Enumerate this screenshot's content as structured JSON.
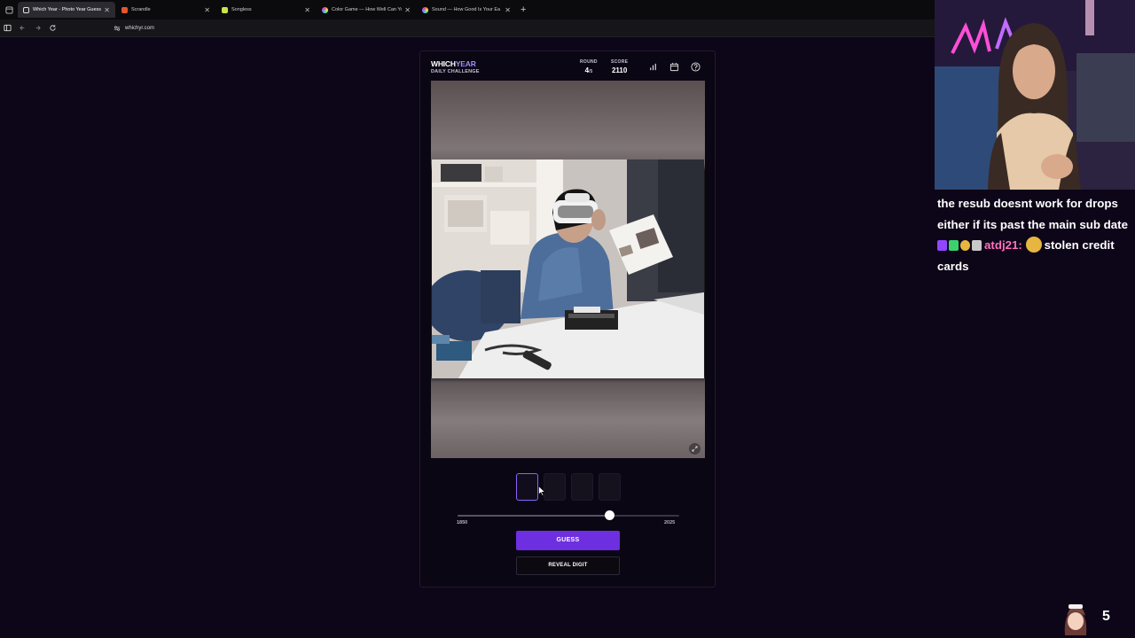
{
  "browser": {
    "tabs": [
      {
        "title": "Which Year - Photo Year Guessi",
        "active": true,
        "favicon_color": "#ffffff"
      },
      {
        "title": "Scrandle",
        "active": false,
        "favicon_color": "#e4572e"
      },
      {
        "title": "Songless",
        "active": false,
        "favicon_color": "#c9e34a"
      },
      {
        "title": "Color Game — How Well Can Yo",
        "active": false,
        "favicon_color": "#ff4fa0"
      },
      {
        "title": "Sound — How Good Is Your Ea",
        "active": false,
        "favicon_color": "#ff4fa0"
      }
    ],
    "tab_close": "✕",
    "new_tab": "+",
    "url": "whichyr.com"
  },
  "game": {
    "logo_which": "WHICH",
    "logo_year": "YEAR",
    "subtitle": "DAILY CHALLENGE",
    "round_label": "ROUND",
    "round_value": "4",
    "round_total": "/5",
    "score_label": "SCORE",
    "score_value": "2110",
    "digits": [
      "",
      "",
      "",
      ""
    ],
    "slider": {
      "min_label": "1850",
      "max_label": "2025",
      "value_fraction": 0.685
    },
    "guess_label": "GUESS",
    "reveal_label": "REVEAL DIGIT",
    "accent": "#6d2fe0"
  },
  "stream": {
    "chat": [
      {
        "text": "the resub doesnt work for drops either if its past the main sub date"
      },
      {
        "user": "atdj21:",
        "text": "stolen credit cards"
      }
    ],
    "viewer_count": "5"
  }
}
